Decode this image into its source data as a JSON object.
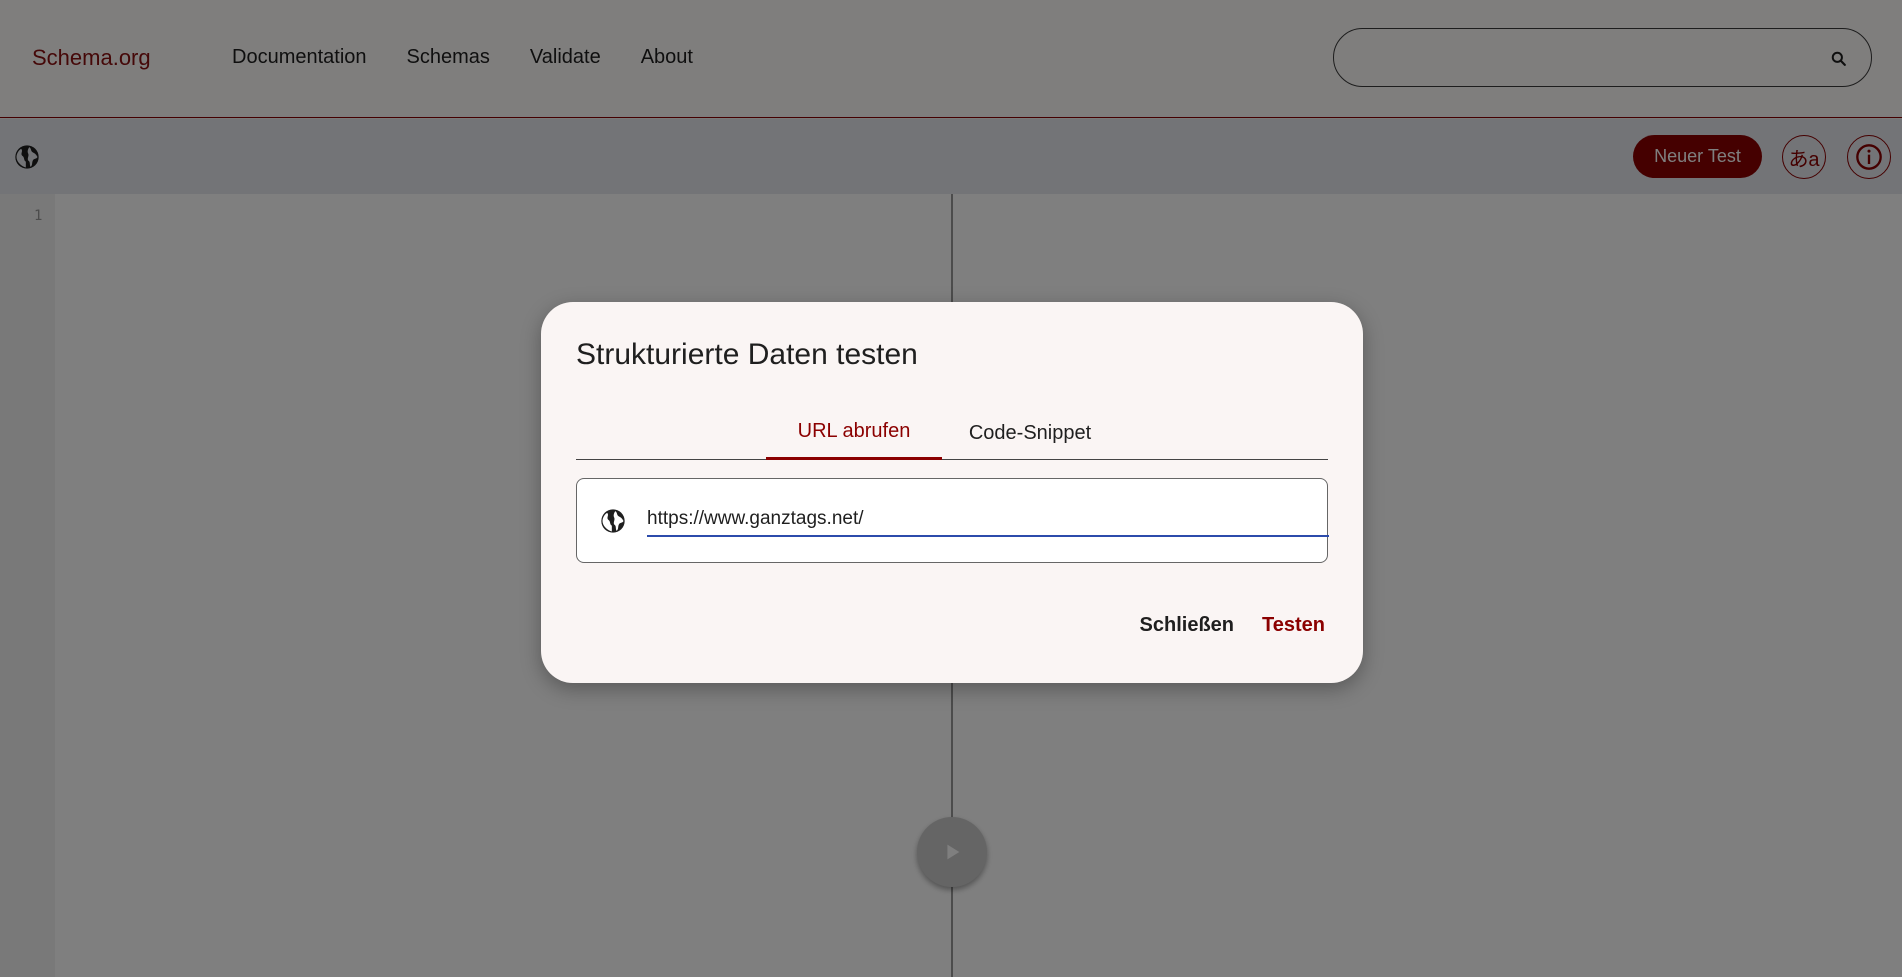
{
  "header": {
    "logo": "Schema.org",
    "nav": [
      "Documentation",
      "Schemas",
      "Validate",
      "About"
    ],
    "search": {
      "placeholder": "",
      "icon": "search-icon"
    }
  },
  "toolbar": {
    "new_test_label": "Neuer Test",
    "language_label": "あa",
    "info_icon": "info-icon"
  },
  "editor": {
    "line_numbers": [
      "1"
    ],
    "run_icon": "play-icon"
  },
  "dialog": {
    "title": "Strukturierte Daten testen",
    "tabs": [
      {
        "label": "URL abrufen",
        "active": true
      },
      {
        "label": "Code-Snippet",
        "active": false
      }
    ],
    "url_value": "https://www.ganztags.net/",
    "close_label": "Schließen",
    "test_label": "Testen"
  },
  "colors": {
    "brand": "#8b0000",
    "input_underline": "#2c4bab",
    "dialog_bg": "#faf5f4"
  }
}
